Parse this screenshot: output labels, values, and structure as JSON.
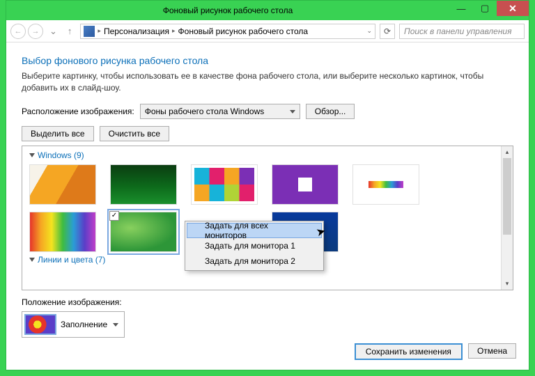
{
  "title": "Фоновый рисунок рабочего стола",
  "breadcrumb": {
    "level1": "Персонализация",
    "level2": "Фоновый рисунок рабочего стола"
  },
  "search": {
    "placeholder": "Поиск в панели управления"
  },
  "heading": "Выбор фонового рисунка рабочего стола",
  "subtext": "Выберите картинку, чтобы использовать ее в качестве фона рабочего стола, или выберите несколько картинок, чтобы добавить их в слайд-шоу.",
  "location": {
    "label": "Расположение изображения:",
    "value": "Фоны рабочего стола Windows",
    "browse": "Обзор..."
  },
  "buttons": {
    "select_all": "Выделить все",
    "clear_all": "Очистить все"
  },
  "groups": {
    "g1": "Windows (9)",
    "g2": "Линии и цвета (7)"
  },
  "context": {
    "item1": "Задать для всех мониторов",
    "item2": "Задать для монитора 1",
    "item3": "Задать для монитора 2"
  },
  "position": {
    "label": "Положение изображения:",
    "value": "Заполнение"
  },
  "footer": {
    "save": "Сохранить изменения",
    "cancel": "Отмена"
  }
}
